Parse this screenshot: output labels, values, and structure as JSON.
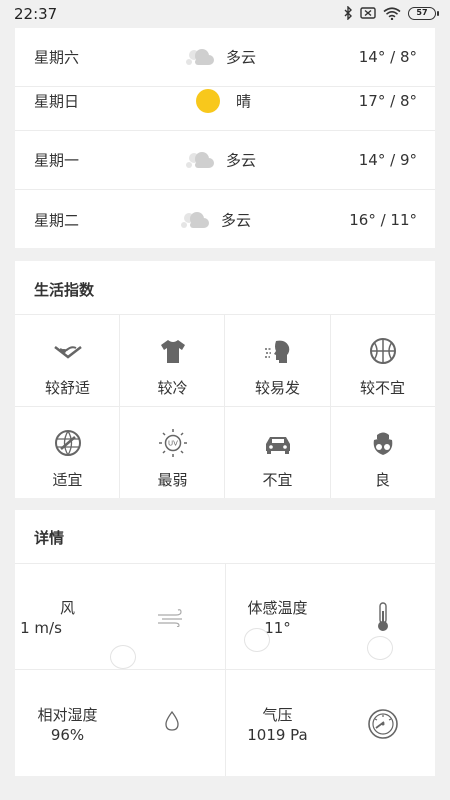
{
  "status_bar": {
    "time": "22:37",
    "battery": "57"
  },
  "forecast": [
    {
      "day": "星期六",
      "icon": "cloudy-icon",
      "condition": "多云",
      "temp": "14° / 8°"
    },
    {
      "day": "星期日",
      "icon": "sunny-icon",
      "condition": "晴",
      "temp": "17° / 8°"
    },
    {
      "day": "星期一",
      "icon": "cloudy-icon",
      "condition": "多云",
      "temp": "14° / 9°"
    },
    {
      "day": "星期二",
      "icon": "cloudy-icon",
      "condition": "多云",
      "temp": "16° / 11°"
    }
  ],
  "life_index": {
    "title": "生活指数",
    "items": [
      {
        "icon": "comfort-icon",
        "label": "较舒适"
      },
      {
        "icon": "clothing-icon",
        "label": "较冷"
      },
      {
        "icon": "cold-illness-icon",
        "label": "较易发"
      },
      {
        "icon": "sports-icon",
        "label": "较不宜"
      },
      {
        "icon": "travel-icon",
        "label": "适宜"
      },
      {
        "icon": "uv-icon",
        "label": "最弱"
      },
      {
        "icon": "car-wash-icon",
        "label": "不宜"
      },
      {
        "icon": "air-quality-icon",
        "label": "良"
      }
    ]
  },
  "details": {
    "title": "详情",
    "items": [
      {
        "name": "风",
        "value": "1 m/s",
        "icon": "wind-icon"
      },
      {
        "name": "体感温度",
        "value": "11°",
        "icon": "thermometer-icon"
      },
      {
        "name": "相对湿度",
        "value": "96%",
        "icon": "humidity-icon"
      },
      {
        "name": "气压",
        "value": "1019 Pa",
        "icon": "pressure-gauge-icon"
      }
    ]
  },
  "colors": {
    "background": "#f0f0f0",
    "card": "#ffffff",
    "sun": "#f8c81c",
    "cloud": "#c8c8c8",
    "icon": "#666666"
  }
}
